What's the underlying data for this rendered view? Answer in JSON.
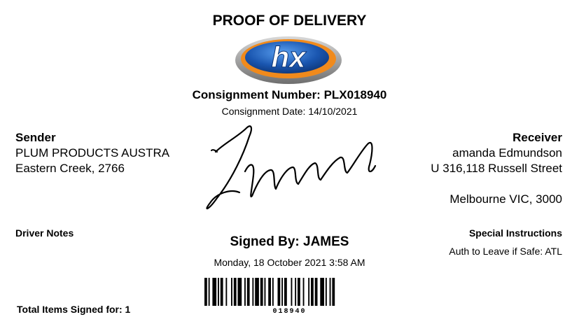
{
  "title": "PROOF OF DELIVERY",
  "logo": {
    "text": "hx",
    "colors": {
      "blue": "#1a56b0",
      "orange": "#f08a1c",
      "gray": "#8a8a8a"
    }
  },
  "consignment": {
    "number_label": "Consignment Number: PLX018940",
    "date_label": "Consignment Date: 14/10/2021"
  },
  "sender": {
    "header": "Sender",
    "line1": "PLUM PRODUCTS AUSTRA",
    "line2": "Eastern Creek, 2766"
  },
  "receiver": {
    "header": "Receiver",
    "line1": "amanda Edmundson",
    "line2": "U 316,118 Russell Street",
    "line3": "Melbourne VIC, 3000"
  },
  "driver_notes": {
    "header": "Driver Notes"
  },
  "signed": {
    "by": "Signed By: JAMES",
    "datetime": "Monday, 18 October 2021 3:58 AM"
  },
  "special_instructions": {
    "header": "Special Instructions",
    "text": "Auth to Leave if Safe: ATL"
  },
  "barcode": {
    "text": "018940"
  },
  "total_items": "Total Items Signed for: 1"
}
